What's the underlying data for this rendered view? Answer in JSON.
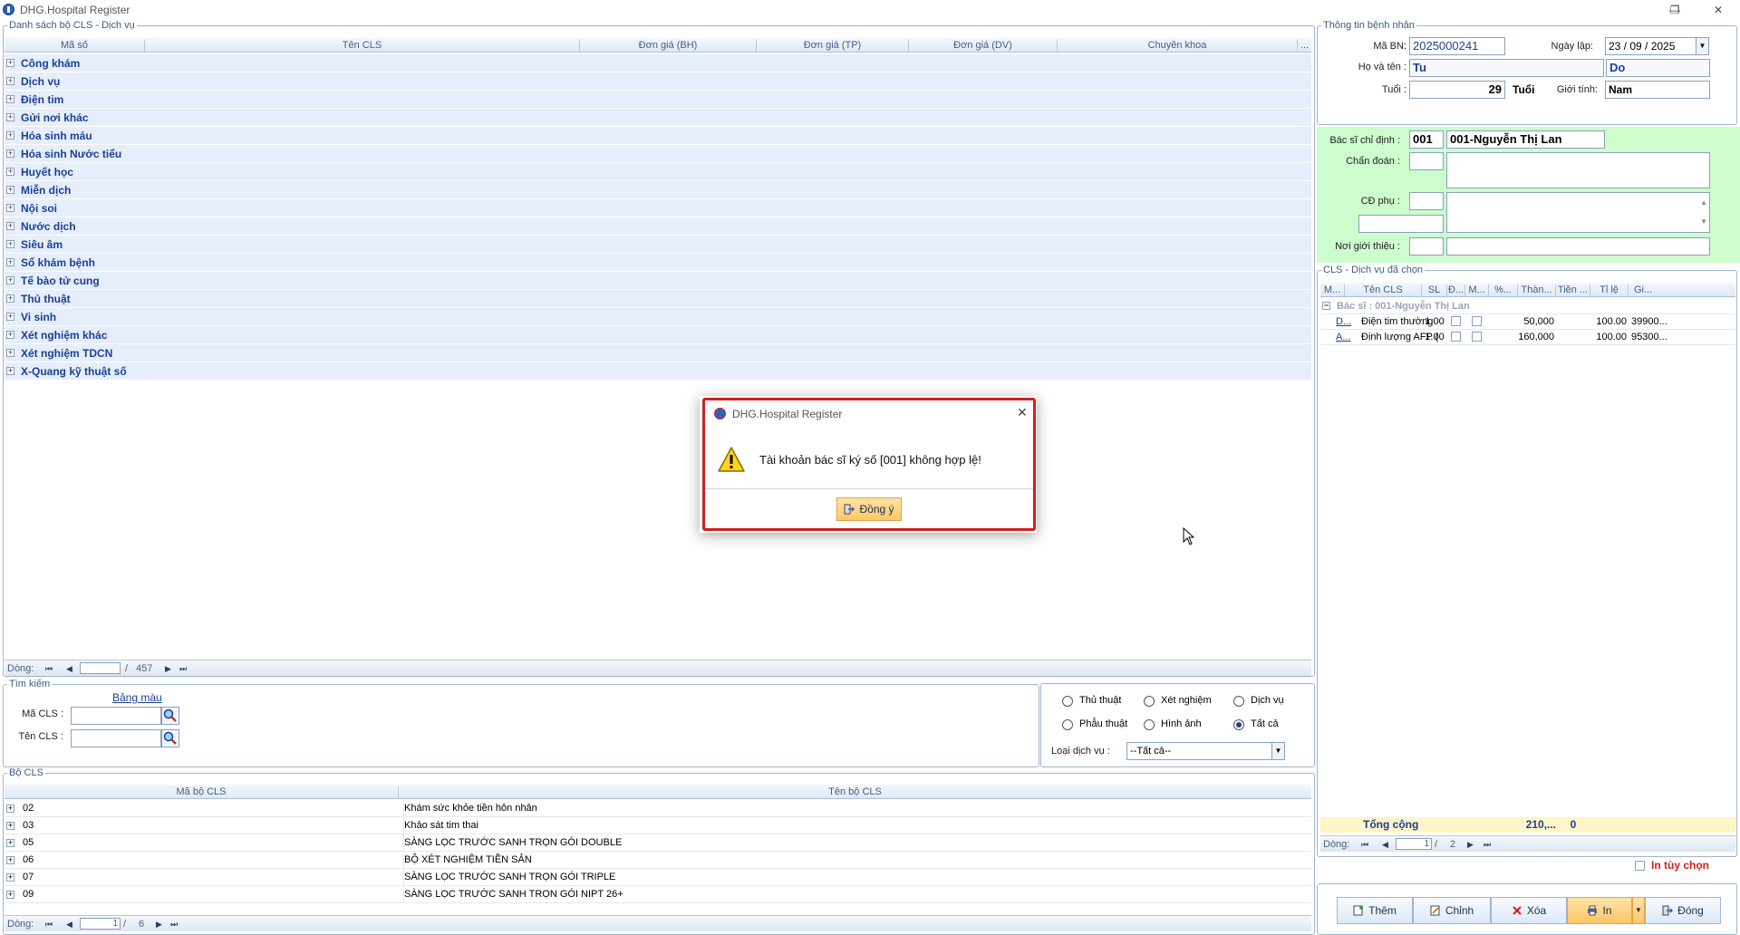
{
  "window": {
    "title": "DHG.Hospital Register",
    "minimize": "—",
    "restore": "❐",
    "close": "✕"
  },
  "cls_list": {
    "legend": "Danh sách bộ CLS - Dịch vụ",
    "columns": [
      "Mã số",
      "Tên CLS",
      "Đơn giá (BH)",
      "Đơn giá (TP)",
      "Đơn giá (DV)",
      "Chuyên khoa",
      "..."
    ],
    "groups": [
      "Công khám",
      "Dịch vụ",
      "Điện tim",
      "Gửi nơi khác",
      "Hóa sinh máu",
      "Hóa sinh Nước tiểu",
      "Huyết học",
      "Miễn dịch",
      "Nội soi",
      "Nước dịch",
      "Siêu âm",
      "Sổ khám bệnh",
      "Tế bào tử cung",
      "Thủ thuật",
      "Vi sinh",
      "Xét nghiệm khác",
      "Xét nghiệm TDCN",
      "X-Quang kỹ thuật số"
    ],
    "nav": {
      "label": "Dòng:",
      "sep": "/",
      "total": "457"
    }
  },
  "search": {
    "legend": "Tìm kiếm",
    "color_link": "Bảng màu",
    "ma_cls_label": "Mã CLS :",
    "ten_cls_label": "Tên CLS :"
  },
  "filter": {
    "options": [
      {
        "label": "Thủ thuật",
        "checked": false
      },
      {
        "label": "Xét nghiệm",
        "checked": false
      },
      {
        "label": "Dịch vụ",
        "checked": false
      },
      {
        "label": "Phẫu thuật",
        "checked": false
      },
      {
        "label": "Hình ảnh",
        "checked": false
      },
      {
        "label": "Tất cả",
        "checked": true
      }
    ],
    "service_type_label": "Loại dịch vụ :",
    "service_type_value": "--Tất cả--"
  },
  "bo_cls": {
    "legend": "Bộ CLS",
    "columns": [
      "Mã bộ CLS",
      "Tên bộ CLS"
    ],
    "rows": [
      {
        "code": "02",
        "name": "Khám sức khỏe tiền hôn nhân"
      },
      {
        "code": "03",
        "name": "Khảo sát tim thai"
      },
      {
        "code": "05",
        "name": "SÀNG LỌC TRƯỚC SANH TRỌN GÓI DOUBLE"
      },
      {
        "code": "06",
        "name": "BỘ XÉT NGHIỆM TIỀN SẢN"
      },
      {
        "code": "07",
        "name": "SÀNG LỌC TRƯỚC SANH TRỌN GÓI TRIPLE"
      },
      {
        "code": "09",
        "name": "SÀNG LỌC TRƯỚC SANH TRỌN GÓI NIPT 26+"
      }
    ],
    "nav": {
      "label": "Dòng:",
      "current": "1",
      "sep": "/",
      "total": "6"
    }
  },
  "patient": {
    "legend": "Thông tin bệnh nhân",
    "ma_bn_label": "Mã BN:",
    "ma_bn": "2025000241",
    "ngay_lap_label": "Ngày lập:",
    "ngay_lap": "23 / 09 / 2025",
    "ho_ten_label": "Họ và tên :",
    "ho": "Tu",
    "ten": "Do",
    "tuoi_label": "Tuổi :",
    "tuoi": "29",
    "tuoi_unit": "Tuổi",
    "gioi_tinh_label": "Giới tính:",
    "gioi_tinh": "Nam"
  },
  "order": {
    "bac_si_label": "Bác sĩ chỉ định :",
    "bac_si_code": "001",
    "bac_si_name": "001-Nguyễn Thị Lan",
    "chan_doan_label": "Chẩn đoán :",
    "cd_phu_label": "CĐ phụ :",
    "noi_gioi_thieu_label": "Nơi giới thiệu :"
  },
  "chosen": {
    "legend": "CLS - Dịch vụ đã chọn",
    "columns": [
      "M...",
      "Tên CLS",
      "SL",
      "Đ...",
      "M...",
      "%...",
      "Thàn...",
      "Tiền ...",
      "Tỉ lệ",
      "Gi..."
    ],
    "group_row": "Bác sĩ :   001-Nguyễn Thị Lan",
    "rows": [
      {
        "code": "D...",
        "name": "Điện tim thường",
        "qty": "1.00",
        "amount": "50,000",
        "rate": "100.00",
        "price": "39900..."
      },
      {
        "code": "A...",
        "name": "Định lượng AFP (Al...",
        "qty": "1.00",
        "amount": "160,000",
        "rate": "100.00",
        "price": "95300..."
      }
    ],
    "total_label": "Tổng cộng",
    "total_amount": "210,...",
    "total_tien": "0",
    "nav": {
      "label": "Dòng:",
      "current": "1",
      "sep": "/",
      "total": "2"
    },
    "print_option": "In tùy chọn"
  },
  "buttons": {
    "add": "Thêm",
    "edit": "Chỉnh",
    "delete": "Xóa",
    "print": "In",
    "close": "Đóng"
  },
  "dialog": {
    "title": "DHG.Hospital Register",
    "message": "Tài khoản bác sĩ ký số [001] không hợp lệ!",
    "ok": "Đồng ý"
  },
  "colors": {
    "accent": "#1a3f96",
    "dialog_border": "#d11f1f",
    "green_panel": "#cdfccd",
    "total_row": "#fff5c8",
    "print_btn": "#ffc766"
  }
}
